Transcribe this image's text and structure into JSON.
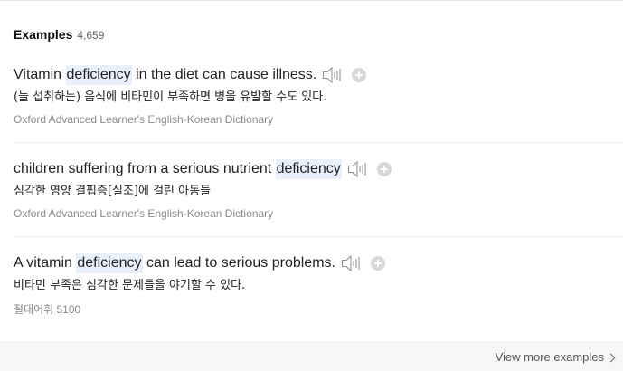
{
  "header": {
    "title": "Examples",
    "count": "4,659"
  },
  "examples": [
    {
      "en_before": "Vitamin ",
      "en_keyword": "deficiency",
      "en_after": " in the diet can cause illness.",
      "ko": "(늘 섭취하는) 음식에 비타민이 부족하면 병을 유발할 수도 있다.",
      "source": "Oxford Advanced Learner's English-Korean Dictionary"
    },
    {
      "en_before": "children suffering from a serious nutrient ",
      "en_keyword": "deficiency",
      "en_after": "",
      "ko": "심각한 영양 결핍증[실조]에 걸린 아동들",
      "source": "Oxford Advanced Learner's English-Korean Dictionary"
    },
    {
      "en_before": "A vitamin ",
      "en_keyword": "deficiency",
      "en_after": " can lead to serious problems.",
      "ko": "비타민 부족은 심각한 문제들을 야기할 수 있다.",
      "source": "절대어휘 5100"
    }
  ],
  "footer": {
    "more_label": "View more examples"
  },
  "icons": {
    "speaker": "speaker-icon",
    "add": "plus-circle-icon",
    "more": "chevron-right-icon"
  },
  "colors": {
    "highlight": "#e8f1fb",
    "icon_gray": "#d8d8d8",
    "source_text": "#8a8a8a"
  }
}
